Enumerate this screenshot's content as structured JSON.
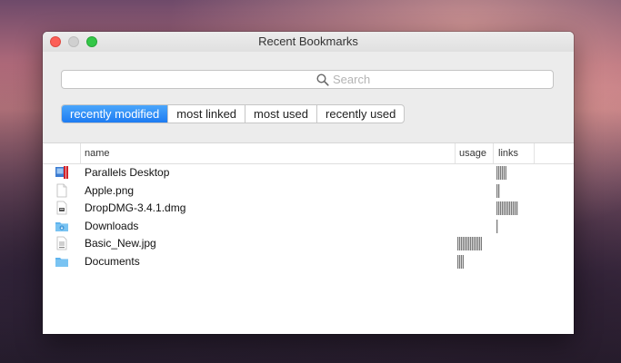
{
  "window": {
    "title": "Recent Bookmarks"
  },
  "search": {
    "placeholder": "Search"
  },
  "filter_tabs": [
    {
      "label": "recently modified",
      "active": true
    },
    {
      "label": "most linked",
      "active": false
    },
    {
      "label": "most used",
      "active": false
    },
    {
      "label": "recently used",
      "active": false
    }
  ],
  "columns": {
    "name": "name",
    "usage": "usage",
    "links": "links"
  },
  "rows": [
    {
      "name": "Parallels Desktop",
      "icon": "parallels-app-icon",
      "usage": 0,
      "links": 0.45
    },
    {
      "name": "Apple.png",
      "icon": "document-icon",
      "usage": 0,
      "links": 0.15
    },
    {
      "name": "DropDMG-3.4.1.dmg",
      "icon": "disk-image-icon",
      "usage": 0,
      "links": 1.0
    },
    {
      "name": "Downloads",
      "icon": "downloads-folder-icon",
      "usage": 0,
      "links": 0.05
    },
    {
      "name": "Basic_New.jpg",
      "icon": "image-file-icon",
      "usage": 1.0,
      "links": 0
    },
    {
      "name": "Documents",
      "icon": "folder-icon",
      "usage": 0.25,
      "links": 0
    }
  ],
  "colors": {
    "accent": "#1d7bf2",
    "folder": "#5fb4ee"
  }
}
